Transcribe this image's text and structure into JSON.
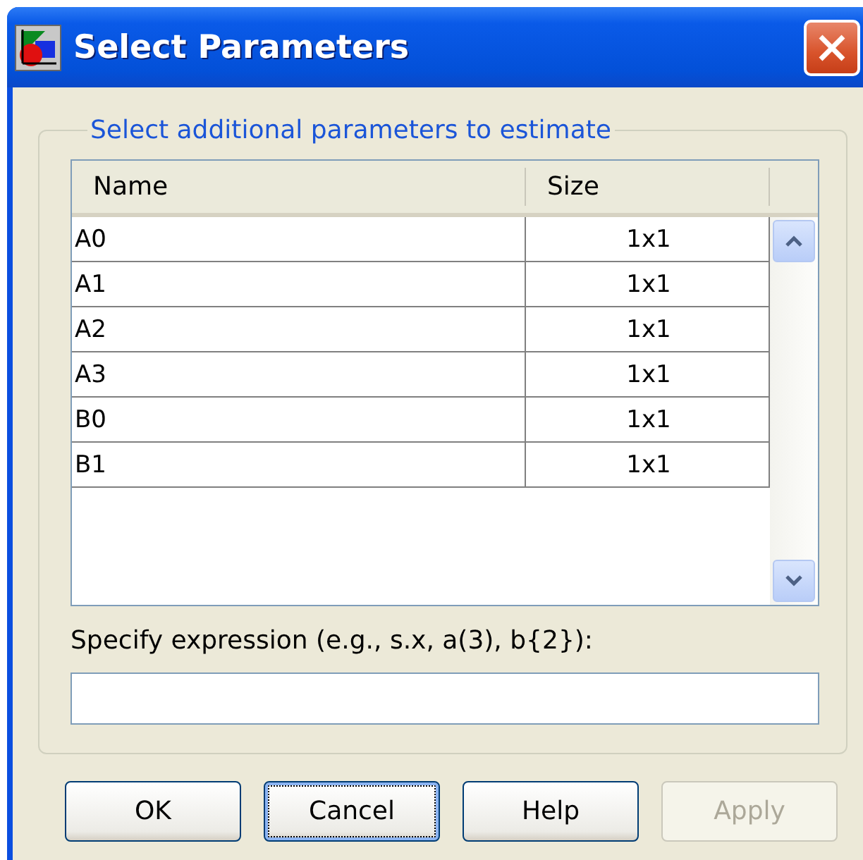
{
  "window": {
    "title": "Select Parameters"
  },
  "group": {
    "legend": "Select additional parameters to estimate"
  },
  "table": {
    "columns": [
      "Name",
      "Size"
    ],
    "rows": [
      {
        "name": "A0",
        "size": "1x1"
      },
      {
        "name": "A1",
        "size": "1x1"
      },
      {
        "name": "A2",
        "size": "1x1"
      },
      {
        "name": "A3",
        "size": "1x1"
      },
      {
        "name": "B0",
        "size": "1x1"
      },
      {
        "name": "B1",
        "size": "1x1"
      }
    ]
  },
  "expression": {
    "label": "Specify expression (e.g., s.x, a(3), b{2}):"
  },
  "buttons": [
    {
      "label": "OK",
      "focused": false,
      "disabled": false
    },
    {
      "label": "Cancel",
      "focused": true,
      "disabled": false
    },
    {
      "label": "Help",
      "focused": false,
      "disabled": false
    },
    {
      "label": "Apply",
      "focused": false,
      "disabled": true
    }
  ]
}
